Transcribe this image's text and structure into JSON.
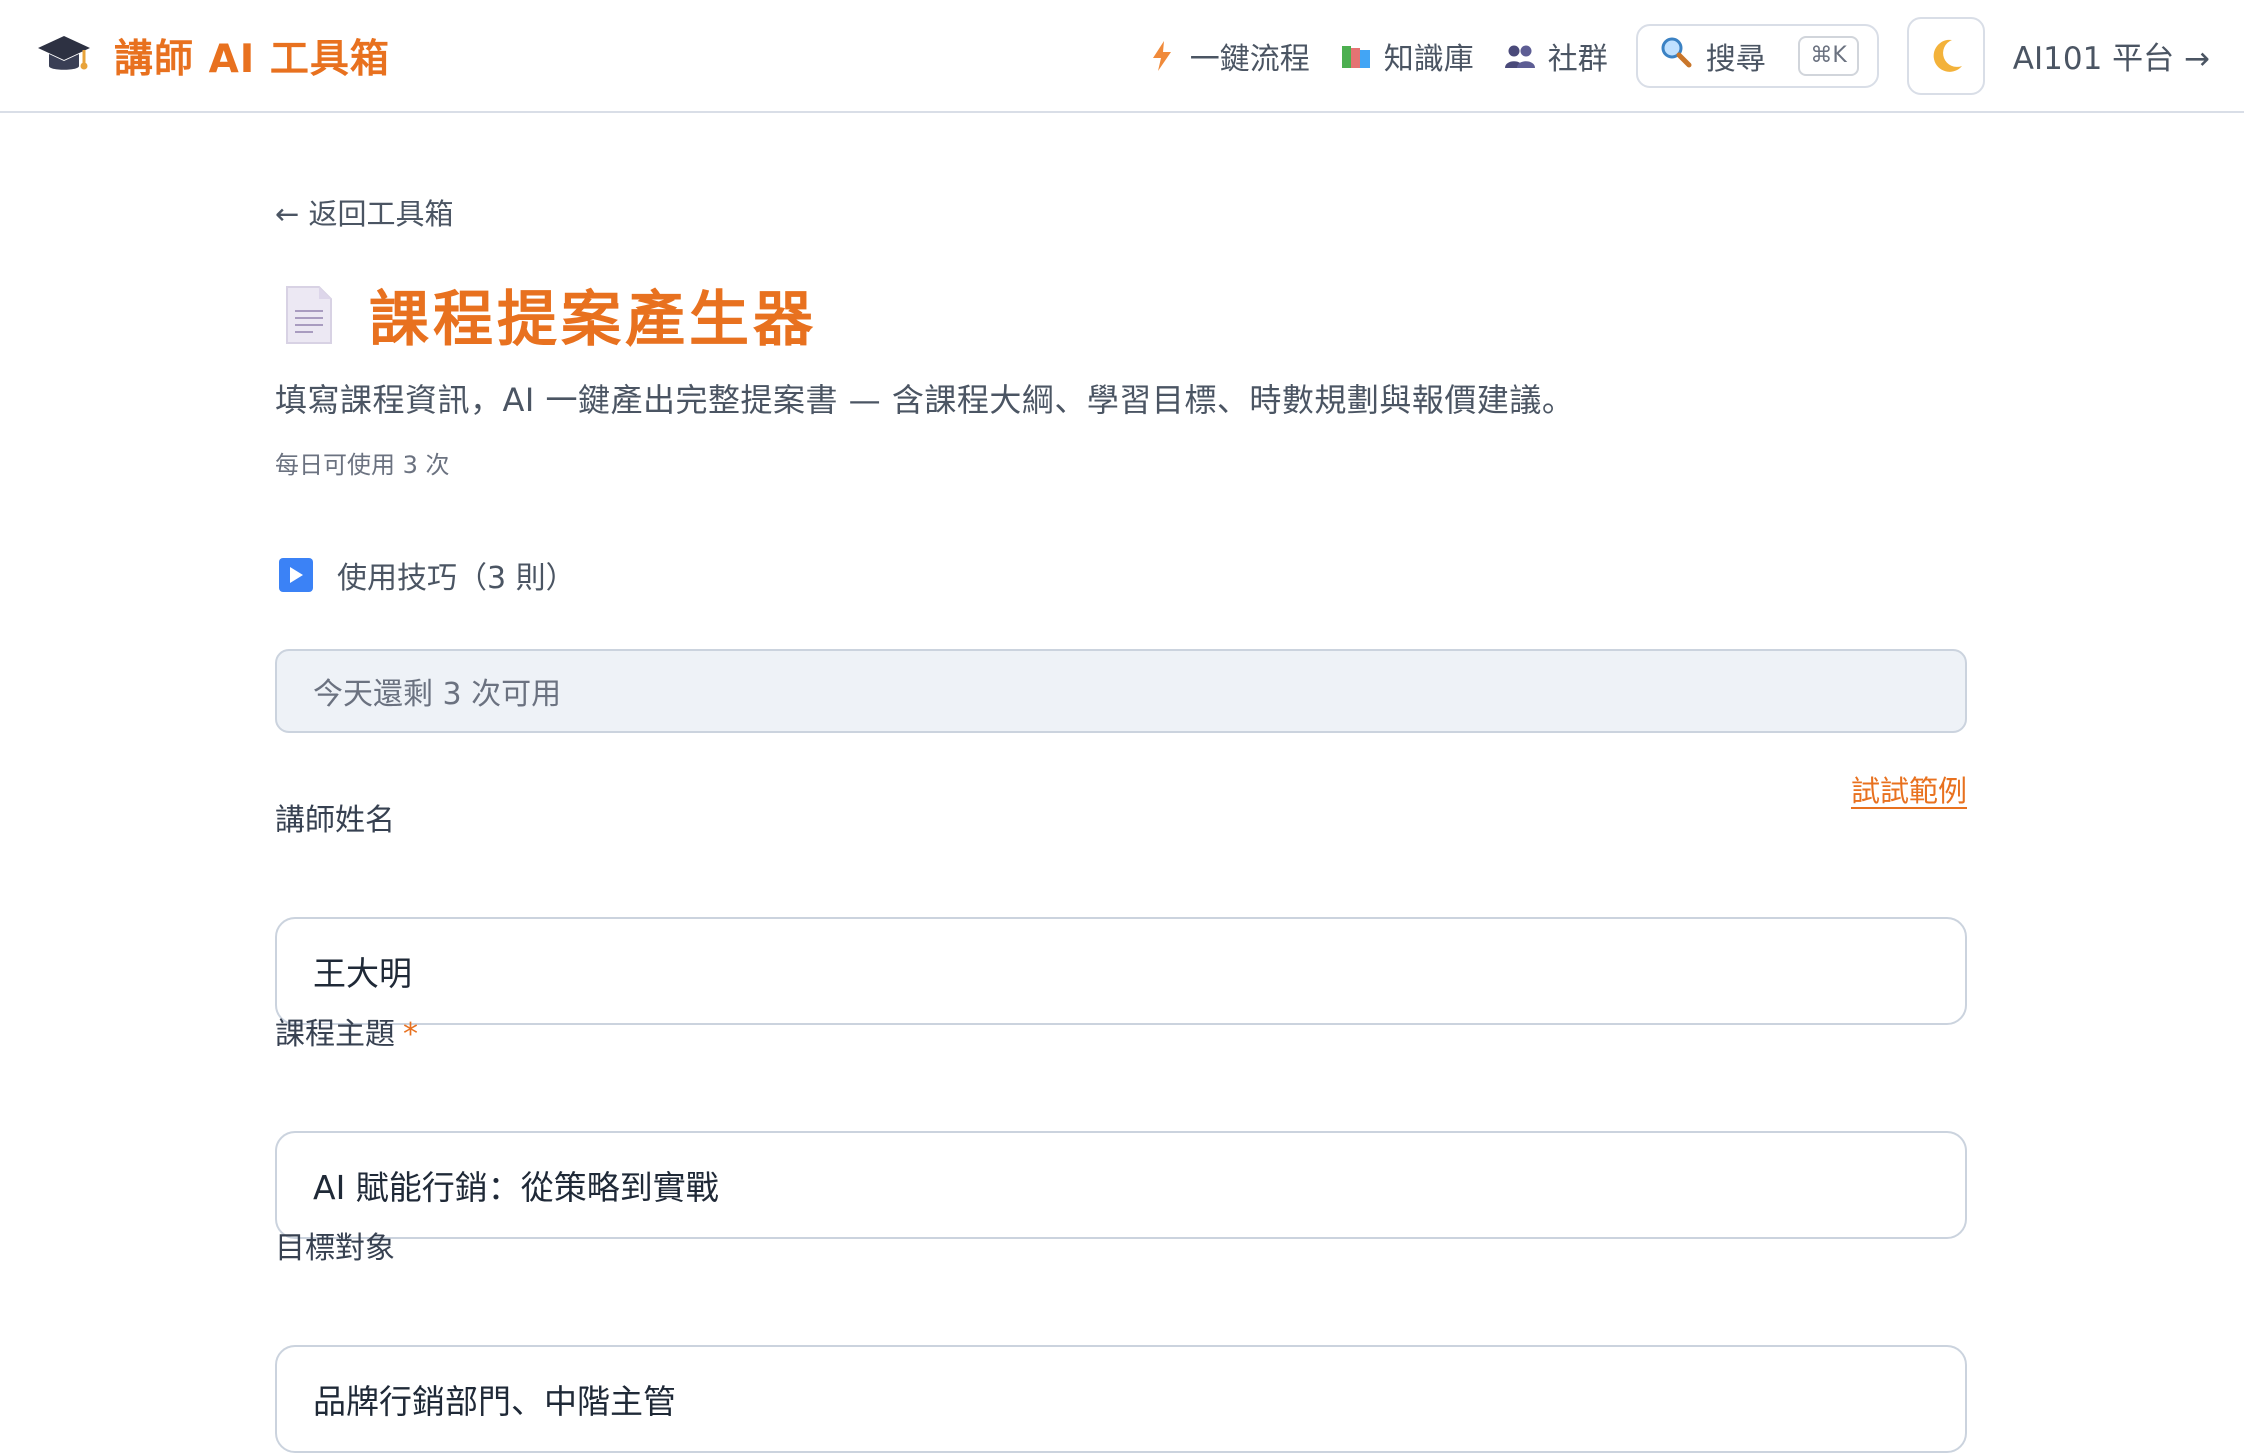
{
  "header": {
    "brand_title": "講師 AI 工具箱",
    "nav": {
      "one_click_flow": "一鍵流程",
      "knowledge_base": "知識庫",
      "community": "社群"
    },
    "search": {
      "label": "搜尋",
      "shortcut": "⌘K"
    },
    "theme_toggle_icon": "moon-icon",
    "platform_link": "AI101 平台 →"
  },
  "main": {
    "back_link": "← 返回工具箱",
    "title": "課程提案產生器",
    "description": "填寫課程資訊，AI 一鍵產出完整提案書 — 含課程大綱、學習目標、時數規劃與報價建議。",
    "usage_note": "每日可使用 3 次",
    "tips_label": "使用技巧（3 則）",
    "remaining_text": "今天還剩 3 次可用",
    "example_link": "試試範例"
  },
  "form": {
    "instructor_name": {
      "label": "講師姓名",
      "value": "王大明"
    },
    "course_topic": {
      "label": "課程主題",
      "required_mark": "*",
      "value": "AI 賦能行銷：從策略到實戰"
    },
    "target_audience": {
      "label": "目標對象",
      "value": "品牌行銷部門、中階主管"
    }
  },
  "colors": {
    "accent": "#e8711f",
    "border": "#cbd3de",
    "muted_bg": "#eef2f7"
  }
}
